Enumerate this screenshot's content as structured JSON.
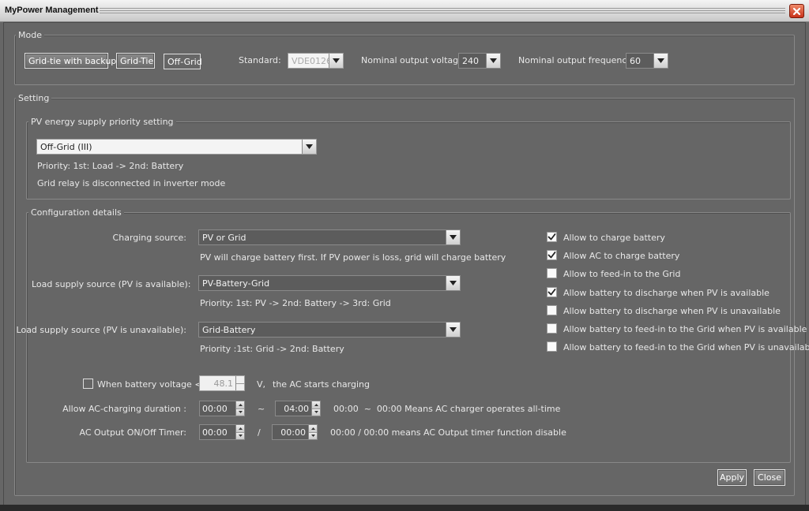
{
  "window": {
    "title": "MyPower Management"
  },
  "mode": {
    "legend": "Mode",
    "buttons": [
      "Grid-tie with backup",
      "Grid-Tie",
      "Off-Grid"
    ],
    "standard_label": "Standard:",
    "standard_value": "VDE0126",
    "voltage_label": "Nominal output voltage:",
    "voltage_value": "240",
    "frequency_label": "Nominal output frequency:",
    "frequency_value": "60"
  },
  "setting": {
    "legend": "Setting",
    "pv_priority": {
      "legend": "PV energy supply priority setting",
      "selected": "Off-Grid (III)",
      "priority_text": "Priority: 1st: Load -> 2nd: Battery",
      "relay_text": "Grid relay is disconnected in inverter mode"
    },
    "config": {
      "legend": "Configuration details",
      "charging_source_label": "Charging source:",
      "charging_source_value": "PV or Grid",
      "charging_source_desc": "PV will charge battery first. If PV power is loss, grid will charge battery",
      "load_pv_avail_label": "Load supply source (PV is available):",
      "load_pv_avail_value": "PV-Battery-Grid",
      "load_pv_avail_desc": "Priority: 1st: PV -> 2nd: Battery -> 3rd: Grid",
      "load_pv_unavail_label": "Load supply source (PV is unavailable):",
      "load_pv_unavail_value": "Grid-Battery",
      "load_pv_unavail_desc": "Priority :1st: Grid -> 2nd: Battery",
      "battery_voltage_label": "When battery voltage <",
      "battery_voltage_value": "48.1",
      "battery_voltage_unit": "V,",
      "battery_voltage_suffix": "the AC starts charging",
      "ac_duration_label": "Allow AC-charging duration :",
      "ac_duration_start": "00:00",
      "ac_duration_sep": "~",
      "ac_duration_end": "04:00",
      "ac_duration_note": "00:00  ~  00:00 Means AC charger operates all-time",
      "ac_timer_label": "AC Output ON/Off Timer:",
      "ac_timer_start": "00:00",
      "ac_timer_sep": "/",
      "ac_timer_end": "00:00",
      "ac_timer_note": "00:00 / 00:00 means AC Output timer function disable",
      "checkboxes": [
        {
          "label": "Allow to charge battery",
          "checked": true
        },
        {
          "label": "Allow AC to charge battery",
          "checked": true
        },
        {
          "label": "Allow to feed-in to the Grid",
          "checked": false
        },
        {
          "label": "Allow battery to discharge when PV is available",
          "checked": true
        },
        {
          "label": "Allow battery to discharge when PV is unavailable",
          "checked": false
        },
        {
          "label": "Allow battery to feed-in to the Grid when PV is available",
          "checked": false
        },
        {
          "label": "Allow battery to feed-in to the Grid when PV is unavailable",
          "checked": false
        }
      ]
    }
  },
  "actions": {
    "apply": "Apply",
    "close": "Close"
  }
}
